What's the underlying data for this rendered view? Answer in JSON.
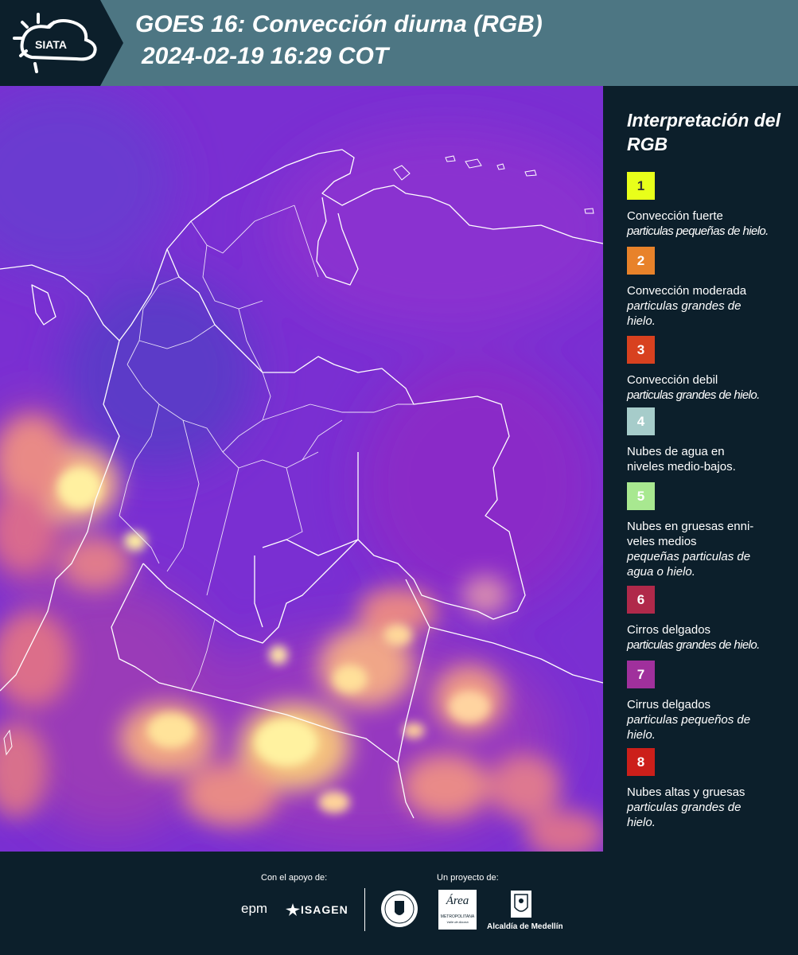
{
  "header": {
    "logo_text": "SIATA",
    "title_line1": "GOES 16: Convección diurna (RGB)",
    "title_line2": "2024-02-19 16:29 COT"
  },
  "legend": {
    "title": "Interpretación del RGB",
    "items": [
      {
        "num": "1",
        "color": "#e8ff1a",
        "text_color": "#333333",
        "label": "Convección fuerte",
        "sub": "particulas pequeñas de hielo."
      },
      {
        "num": "2",
        "color": "#e8822a",
        "text_color": "#ffffff",
        "label": "Convección moderada",
        "sub": "particulas grandes de hielo."
      },
      {
        "num": "3",
        "color": "#d8411f",
        "text_color": "#ffffff",
        "label": "Convección debil",
        "sub": "particulas grandes de hielo."
      },
      {
        "num": "4",
        "color": "#a6ccca",
        "text_color": "#ffffff",
        "label": "Nubes de agua en niveles medio-bajos.",
        "sub": ""
      },
      {
        "num": "5",
        "color": "#a8e890",
        "text_color": "#ffffff",
        "label": "Nubes en gruesas enni- veles medios",
        "sub": "pequeñas particulas de agua o hielo."
      },
      {
        "num": "6",
        "color": "#b0294a",
        "text_color": "#ffffff",
        "label": "Cirros delgados",
        "sub": "particulas grandes de hielo."
      },
      {
        "num": "7",
        "color": "#a0309c",
        "text_color": "#ffffff",
        "label": "Cirrus delgados",
        "sub": "particulas pequeños de hielo."
      },
      {
        "num": "8",
        "color": "#cc1f1a",
        "text_color": "#ffffff",
        "label": "Nubes altas y gruesas",
        "sub": "particulas grandes de hielo."
      }
    ]
  },
  "footer": {
    "support_label": "Con el apoyo de:",
    "project_label": "Un proyecto de:",
    "sponsor1": "epm",
    "sponsor2": "ISAGEN",
    "area_text": "Área",
    "area_sub": "METROPOLITANA",
    "area_sub2": "Valle de Aburrá",
    "alcaldia": "Alcaldía de Medellín"
  }
}
